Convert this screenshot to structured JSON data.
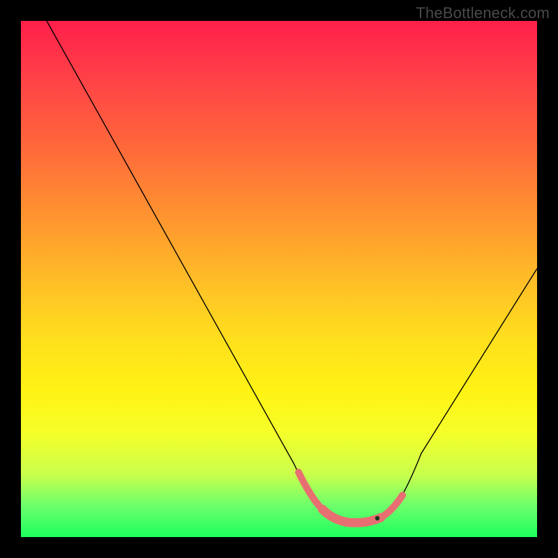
{
  "attribution": "TheBottleneck.com",
  "colors": {
    "frame_border": "#000000",
    "curve": "#000000",
    "segment_pink": "#e86f71",
    "segment_green": "#28c85a"
  },
  "chart_data": {
    "type": "line",
    "title": "",
    "xlabel": "",
    "ylabel": "",
    "xlim": [
      0,
      100
    ],
    "ylim": [
      0,
      100
    ],
    "x": [
      5,
      10,
      15,
      20,
      25,
      30,
      35,
      40,
      45,
      50,
      53,
      56,
      58,
      60,
      62,
      65,
      68,
      70,
      72,
      75,
      80,
      85,
      90,
      95,
      100
    ],
    "values": [
      100,
      91,
      82,
      73,
      64,
      55,
      46,
      37,
      28,
      19,
      13,
      8.5,
      6,
      4.5,
      3.5,
      3,
      3,
      3.5,
      4.5,
      8,
      16,
      25,
      34,
      43,
      52
    ],
    "highlighted_segments_x": [
      [
        53,
        58
      ],
      [
        58,
        70
      ],
      [
        70,
        73.5
      ]
    ],
    "highlighted_segments_color": [
      "pink",
      "pink_thick",
      "pink"
    ],
    "background_gradient": "red-yellow-green vertical"
  }
}
